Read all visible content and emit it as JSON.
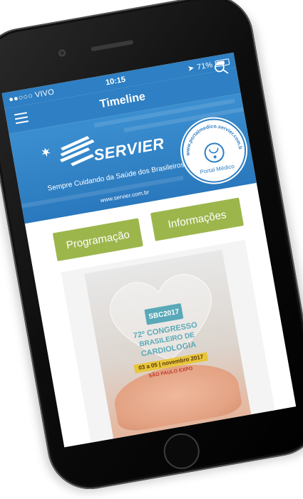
{
  "status_bar": {
    "carrier": "●●○○○ VIVO",
    "time": "10:15",
    "battery_percent": "71%",
    "battery_level": 0.71
  },
  "nav": {
    "title": "Timeline",
    "menu_icon": "hamburger-icon",
    "search_icon": "search-icon"
  },
  "banner": {
    "brand_name": "SERVIER",
    "tagline": "Sempre Cuidando da Saúde dos Brasileiros",
    "url": "www.servier.com.br",
    "seal_text": "www.portalmedico.servier.com.br",
    "seal_label": "Portal Médico"
  },
  "buttons": {
    "programacao": "Programação",
    "informacoes": "Informações"
  },
  "poster": {
    "badge": "SBC2017",
    "line1": "72º CONGRESSO",
    "line2": "BRASILEIRO DE",
    "line3": "CARDIOLOGIA",
    "date": "03 a 05 | novembro 2017",
    "venue": "SÃO PAULO EXPO"
  },
  "colors": {
    "primary": "#2e7fc3",
    "accent": "#9cb64c"
  }
}
